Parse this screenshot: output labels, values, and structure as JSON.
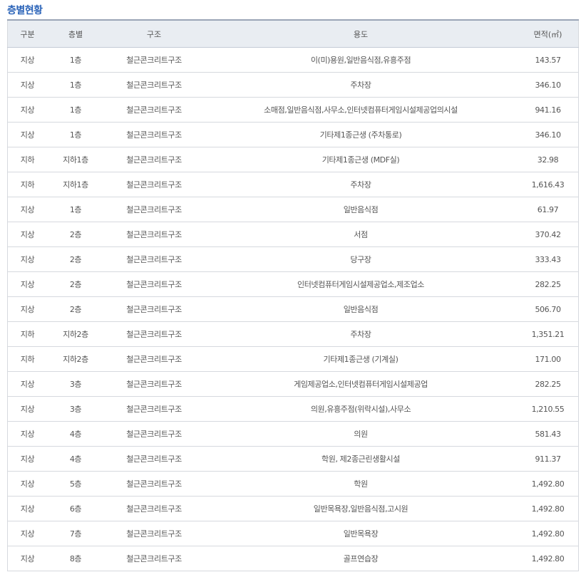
{
  "section_title": "층별현황",
  "headers": {
    "gubun": "구분",
    "floor": "층별",
    "structure": "구조",
    "use": "용도",
    "area": "면적(㎡)"
  },
  "rows": [
    {
      "gubun": "지상",
      "floor": "1층",
      "structure": "철근콘크리트구조",
      "use": "이(미)용원,일반음식점,유흥주점",
      "area": "143.57"
    },
    {
      "gubun": "지상",
      "floor": "1층",
      "structure": "철근콘크리트구조",
      "use": "주차장",
      "area": "346.10"
    },
    {
      "gubun": "지상",
      "floor": "1층",
      "structure": "철근콘크리트구조",
      "use": "소매점,일반음식점,사무소,인터넷컴퓨터게임시설제공업의시설",
      "area": "941.16"
    },
    {
      "gubun": "지상",
      "floor": "1층",
      "structure": "철근콘크리트구조",
      "use": "기타제1종근생 (주차통로)",
      "area": "346.10"
    },
    {
      "gubun": "지하",
      "floor": "지하1층",
      "structure": "철근콘크리트구조",
      "use": "기타제1종근생 (MDF실)",
      "area": "32.98"
    },
    {
      "gubun": "지하",
      "floor": "지하1층",
      "structure": "철근콘크리트구조",
      "use": "주차장",
      "area": "1,616.43"
    },
    {
      "gubun": "지상",
      "floor": "1층",
      "structure": "철근콘크리트구조",
      "use": "일반음식점",
      "area": "61.97"
    },
    {
      "gubun": "지상",
      "floor": "2층",
      "structure": "철근콘크리트구조",
      "use": "서점",
      "area": "370.42"
    },
    {
      "gubun": "지상",
      "floor": "2층",
      "structure": "철근콘크리트구조",
      "use": "당구장",
      "area": "333.43"
    },
    {
      "gubun": "지상",
      "floor": "2층",
      "structure": "철근콘크리트구조",
      "use": "인터넷컴퓨터게임시설제공업소,제조업소",
      "area": "282.25"
    },
    {
      "gubun": "지상",
      "floor": "2층",
      "structure": "철근콘크리트구조",
      "use": "일반음식점",
      "area": "506.70"
    },
    {
      "gubun": "지하",
      "floor": "지하2층",
      "structure": "철근콘크리트구조",
      "use": "주차장",
      "area": "1,351.21"
    },
    {
      "gubun": "지하",
      "floor": "지하2층",
      "structure": "철근콘크리트구조",
      "use": "기타제1종근생 (기계실)",
      "area": "171.00"
    },
    {
      "gubun": "지상",
      "floor": "3층",
      "structure": "철근콘크리트구조",
      "use": "게임제공업소,인터넷컴퓨터게임시설제공업",
      "area": "282.25"
    },
    {
      "gubun": "지상",
      "floor": "3층",
      "structure": "철근콘크리트구조",
      "use": "의원,유흥주점(위락시설),사무소",
      "area": "1,210.55"
    },
    {
      "gubun": "지상",
      "floor": "4층",
      "structure": "철근콘크리트구조",
      "use": "의원",
      "area": "581.43"
    },
    {
      "gubun": "지상",
      "floor": "4층",
      "structure": "철근콘크리트구조",
      "use": "학원, 제2종근린생활시설",
      "area": "911.37"
    },
    {
      "gubun": "지상",
      "floor": "5층",
      "structure": "철근콘크리트구조",
      "use": "학원",
      "area": "1,492.80"
    },
    {
      "gubun": "지상",
      "floor": "6층",
      "structure": "철근콘크리트구조",
      "use": "일반목욕장,일반음식점,고시원",
      "area": "1,492.80"
    },
    {
      "gubun": "지상",
      "floor": "7층",
      "structure": "철근콘크리트구조",
      "use": "일반목욕장",
      "area": "1,492.80"
    },
    {
      "gubun": "지상",
      "floor": "8층",
      "structure": "철근콘크리트구조",
      "use": "골프연습장",
      "area": "1,492.80"
    }
  ]
}
